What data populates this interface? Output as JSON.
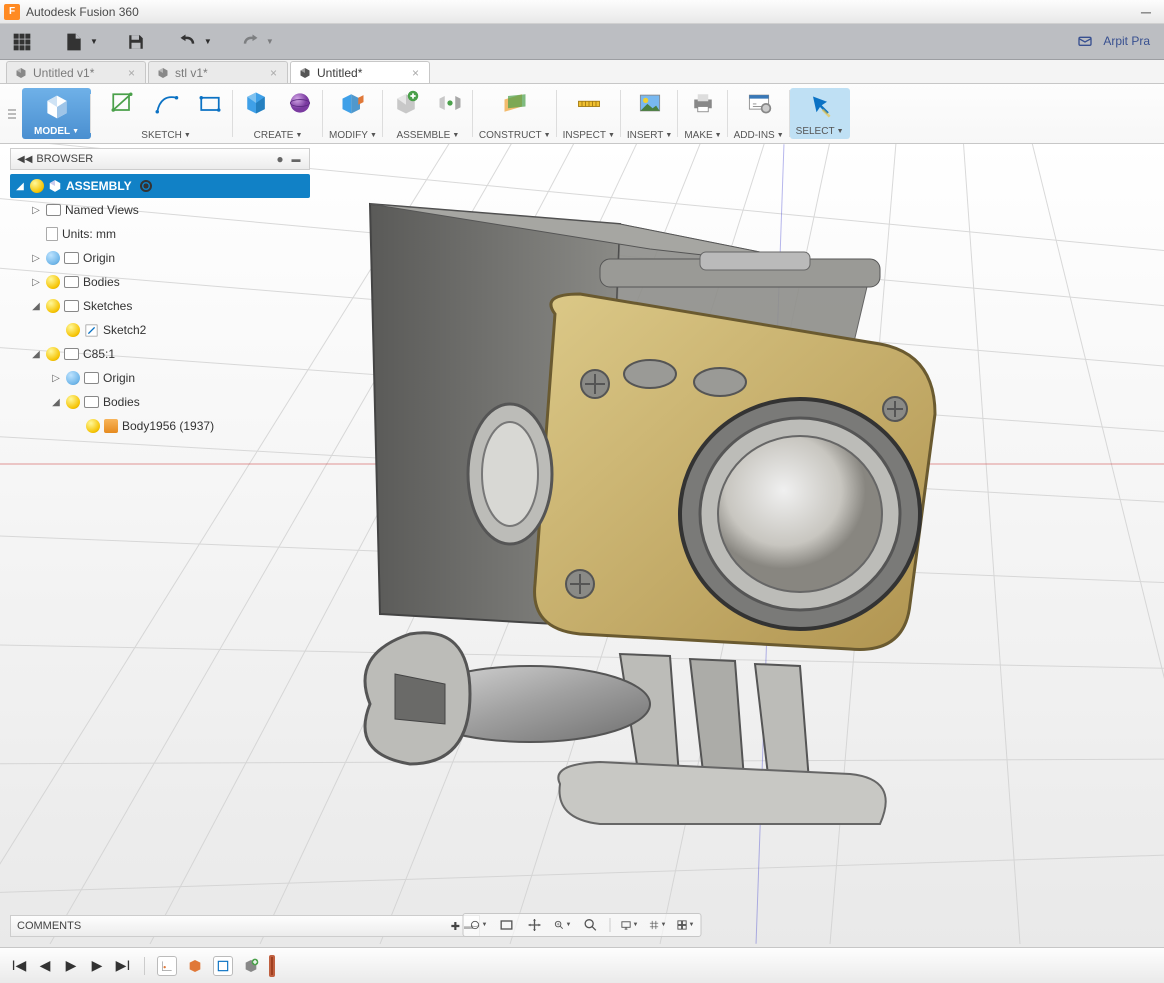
{
  "title": "Autodesk Fusion 360",
  "user": "Arpit Pra",
  "tabs": [
    {
      "label": "Untitled v1*",
      "active": false
    },
    {
      "label": "stl v1*",
      "active": false
    },
    {
      "label": "Untitled*",
      "active": true
    }
  ],
  "ribbon": {
    "model": "MODEL",
    "groups": [
      {
        "label": "SKETCH"
      },
      {
        "label": "CREATE"
      },
      {
        "label": "MODIFY"
      },
      {
        "label": "ASSEMBLE"
      },
      {
        "label": "CONSTRUCT"
      },
      {
        "label": "INSPECT"
      },
      {
        "label": "INSERT"
      },
      {
        "label": "MAKE"
      },
      {
        "label": "ADD-INS"
      },
      {
        "label": "SELECT"
      }
    ]
  },
  "browser": {
    "title": "BROWSER",
    "root": "ASSEMBLY",
    "items": {
      "named_views": "Named Views",
      "units": "Units: mm",
      "origin": "Origin",
      "bodies": "Bodies",
      "sketches": "Sketches",
      "sketch2": "Sketch2",
      "c85": "C85:1",
      "origin2": "Origin",
      "bodies2": "Bodies",
      "body1956": "Body1956 (1937)"
    }
  },
  "comments": "COMMENTS"
}
